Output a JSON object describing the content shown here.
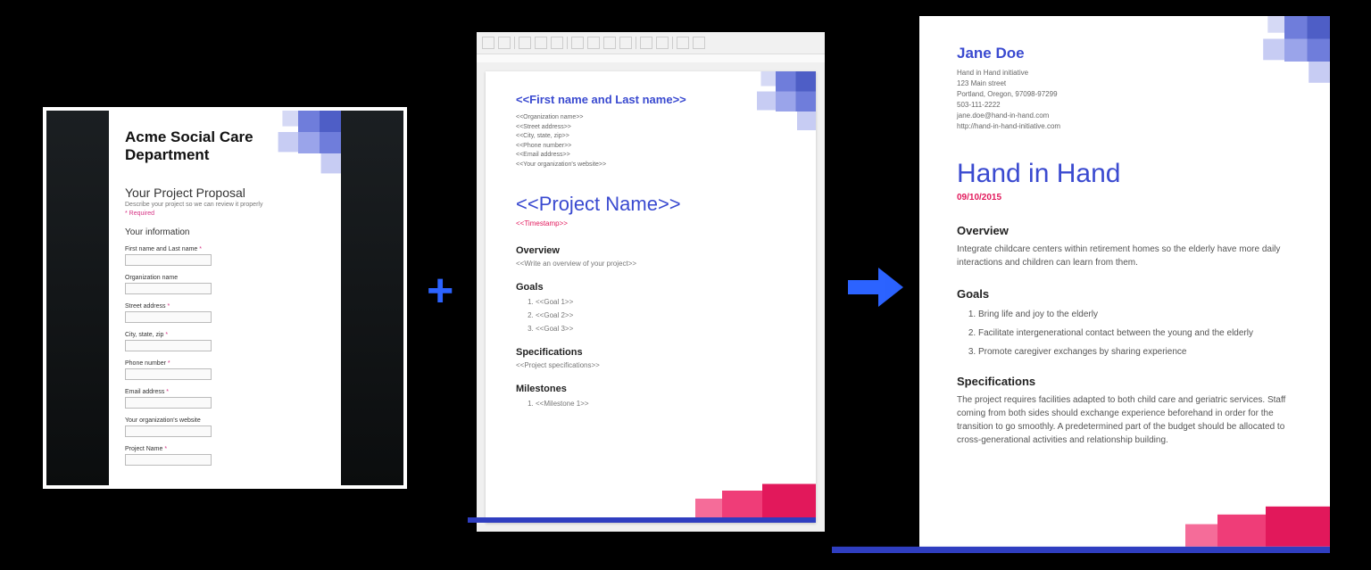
{
  "form": {
    "header": "Acme Social Care Department",
    "title": "Your Project Proposal",
    "subtitle": "Describe your project so we can review it properly",
    "required_note": "* Required",
    "section_title": "Your information",
    "fields": [
      {
        "label": "First name and Last name",
        "required": true
      },
      {
        "label": "Organization name",
        "required": false
      },
      {
        "label": "Street address",
        "required": true
      },
      {
        "label": "City, state, zip",
        "required": true
      },
      {
        "label": "Phone number",
        "required": true
      },
      {
        "label": "Email address",
        "required": true
      },
      {
        "label": "Your organization's website",
        "required": false
      },
      {
        "label": "Project Name",
        "required": true
      }
    ]
  },
  "template": {
    "name_ph": "<<First name and Last name>>",
    "meta": [
      "<<Organization name>>",
      "<<Street address>>",
      "<<City, state, zip>>",
      "<<Phone number>>",
      "<<Email address>>",
      "<<Your organization's website>>"
    ],
    "project_ph": "<<Project Name>>",
    "timestamp_ph": "<<Timestamp>>",
    "sections": {
      "overview": {
        "title": "Overview",
        "body": "<<Write an overview of your project>>"
      },
      "goals": {
        "title": "Goals",
        "items": [
          "<<Goal 1>>",
          "<<Goal 2>>",
          "<<Goal 3>>"
        ]
      },
      "specs": {
        "title": "Specifications",
        "body": "<<Project specifications>>"
      },
      "milestones": {
        "title": "Milestones",
        "items": [
          "<<Milestone 1>>"
        ]
      }
    }
  },
  "output": {
    "name": "Jane Doe",
    "meta": [
      "Hand in Hand initiative",
      "123 Main street",
      "Portland, Oregon, 97098-97299",
      "503-111-2222",
      "jane.doe@hand-in-hand.com",
      "http://hand-in-hand-initiative.com"
    ],
    "project": "Hand in Hand",
    "timestamp": "09/10/2015",
    "overview": {
      "title": "Overview",
      "body": "Integrate childcare centers within retirement homes so the elderly have more daily interactions and children can learn from them."
    },
    "goals": {
      "title": "Goals",
      "items": [
        "Bring life and joy to the elderly",
        "Facilitate intergenerational contact between the young and the elderly",
        "Promote caregiver exchanges by sharing experience"
      ]
    },
    "specs": {
      "title": "Specifications",
      "body": "The project requires facilities adapted to both child care and geriatric services. Staff coming from both sides should exchange experience beforehand in order for the transition to go smoothly. A predetermined part of the budget should be allocated to cross-generational activities and relationship building."
    }
  },
  "operators": {
    "plus": "+"
  }
}
